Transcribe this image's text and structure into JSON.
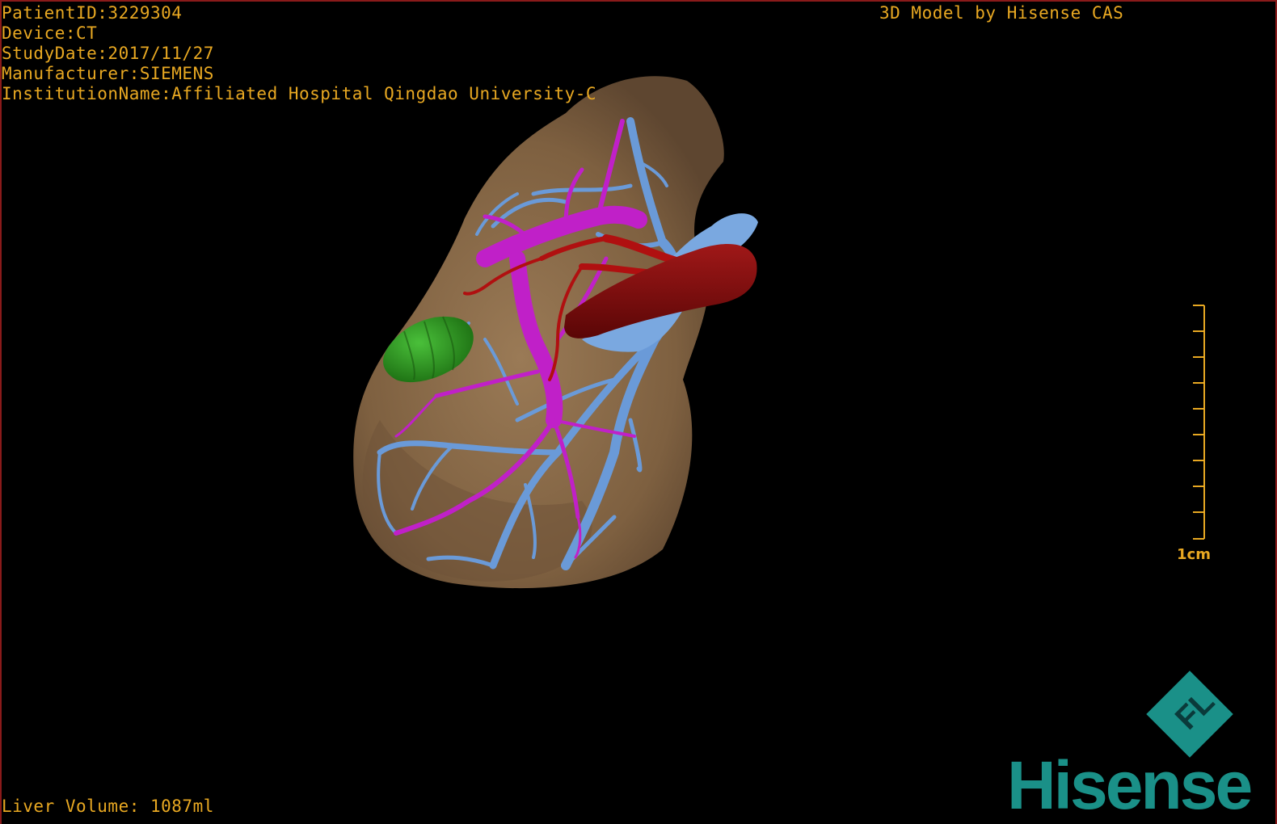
{
  "study_info": {
    "patient_id": "PatientID:3229304",
    "device": "Device:CT",
    "study_date": "StudyDate:2017/11/27",
    "manufacturer": "Manufacturer:SIEMENS",
    "institution": "InstitutionName:Affiliated Hospital Qingdao University-C"
  },
  "model_credit": "3D Model by Hisense CAS",
  "liver_volume": "Liver Volume: 1087ml",
  "scale_bar": {
    "label": "1cm"
  },
  "logo": {
    "wordmark": "Hisense",
    "emblem_letters": "FL"
  },
  "colors": {
    "overlay_text": "#e8a822",
    "liver": "#8a6a48",
    "portal_vein": "#c020c8",
    "hepatic_vein": "#6a9ad8",
    "artery": "#8a0a0a",
    "lesion": "#2a9a1a",
    "logo": "#1a9088",
    "frame": "#8a1a1a"
  }
}
